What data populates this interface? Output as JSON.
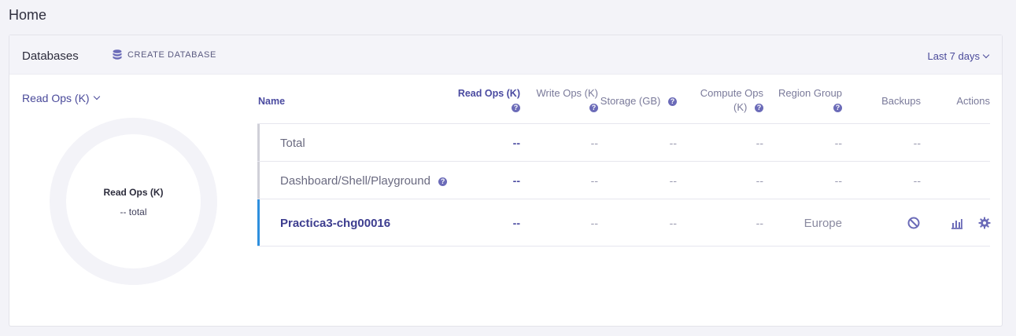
{
  "page": {
    "title": "Home"
  },
  "panel": {
    "title": "Databases",
    "create_label": "CREATE DATABASE",
    "range_label": "Last 7 days"
  },
  "metric": {
    "selected": "Read Ops (K)"
  },
  "donut": {
    "title": "Read Ops (K)",
    "subtitle": "-- total"
  },
  "table": {
    "headers": {
      "name": "Name",
      "read_ops": "Read Ops (K)",
      "write_ops": "Write Ops (K)",
      "storage": "Storage (GB)",
      "compute_ops_1": "Compute Ops",
      "compute_ops_2": "(K)",
      "region_group": "Region Group",
      "backups": "Backups",
      "actions": "Actions"
    },
    "rows": [
      {
        "name": "Total",
        "read_ops": "--",
        "write_ops": "--",
        "storage": "--",
        "compute_ops": "--",
        "region": "--",
        "backups": "--"
      },
      {
        "name": "Dashboard/Shell/Playground",
        "read_ops": "--",
        "write_ops": "--",
        "storage": "--",
        "compute_ops": "--",
        "region": "--",
        "backups": "--"
      },
      {
        "name": "Practica3-chg00016",
        "read_ops": "--",
        "write_ops": "--",
        "storage": "--",
        "compute_ops": "--",
        "region": "Europe",
        "backups_icon": "disabled-circle-icon",
        "actions_icons": [
          "bar-chart-icon",
          "gear-icon"
        ]
      }
    ]
  },
  "colors": {
    "accent": "#4a4aa0",
    "selected_bar": "#2e8fde",
    "icon": "#6b6bb8"
  }
}
